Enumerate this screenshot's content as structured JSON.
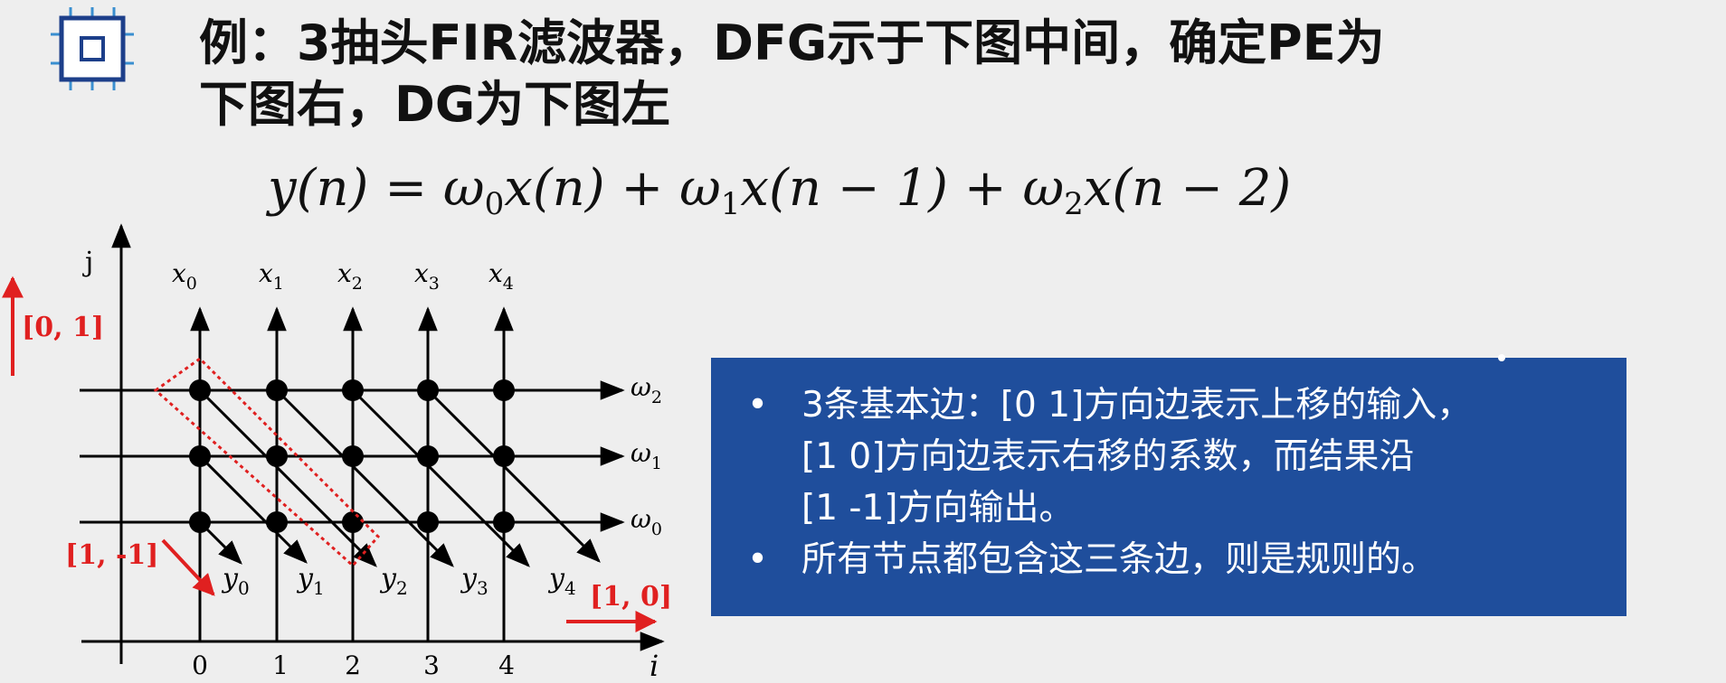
{
  "title": {
    "line1": "例：3抽头FIR滤波器，DFG示于下图中间，确定PE为",
    "line2": "下图右，DG为下图左"
  },
  "formula": {
    "lhs": "y(n) = ",
    "term0_coef": "ω",
    "term0_sub": "0",
    "term0_arg": "x(n) + ",
    "term1_coef": "ω",
    "term1_sub": "1",
    "term1_arg": "x(n − 1) + ",
    "term2_coef": "ω",
    "term2_sub": "2",
    "term2_arg": "x(n − 2)"
  },
  "diagram": {
    "axis_i_label": "i",
    "axis_j_label": "j",
    "i_ticks": [
      "0",
      "1",
      "2",
      "3",
      "4"
    ],
    "x_inputs": [
      "x",
      "x",
      "x",
      "x",
      "x"
    ],
    "x_subs": [
      "0",
      "1",
      "2",
      "3",
      "4"
    ],
    "y_outputs": [
      "y",
      "y",
      "y",
      "y",
      "y"
    ],
    "y_subs": [
      "0",
      "1",
      "2",
      "3",
      "4"
    ],
    "weights": [
      "ω",
      "ω",
      "ω"
    ],
    "weight_subs": [
      "2",
      "1",
      "0"
    ],
    "dir_up": "[0, 1]",
    "dir_diag": "[1, -1]",
    "dir_right": "[1, 0]",
    "red_color": "#e02020"
  },
  "info": {
    "bullet_char": "•",
    "bullet1_lines": [
      "3条基本边：[0 1]方向边表示上移的输入，",
      "[1 0]方向边表示右移的系数，而结果沿",
      "[1 -1]方向输出。"
    ],
    "bullet2_lines": [
      "所有节点都包含这三条边，则是规则的。"
    ],
    "bg_color": "#1f4e9c"
  }
}
